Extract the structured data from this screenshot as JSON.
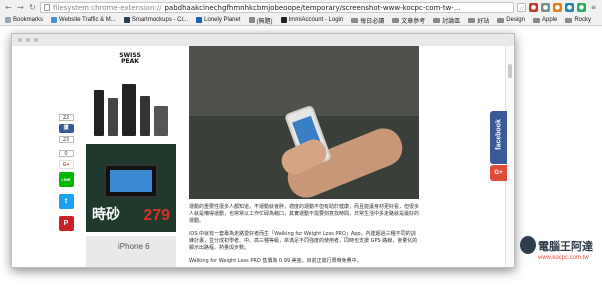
{
  "browser": {
    "url_scheme": "filesystem:chrome-extension://",
    "url_path": "pabdhaakclnechgfhmnhkcbmjobeoope/temporary/screenshot-www-kocpc-com-tw-...",
    "back_icon": "back-arrow-icon",
    "forward_icon": "forward-arrow-icon",
    "reload_icon": "reload-icon",
    "extension_icons": [
      "star-icon",
      "extension-icon-1",
      "extension-icon-2",
      "extension-icon-3",
      "extension-icon-4",
      "extension-icon-5",
      "menu-icon"
    ]
  },
  "bookmarks": {
    "apps_label": "Bookmarks",
    "items": [
      {
        "label": "Website Traffic & M...",
        "type": "page"
      },
      {
        "label": "Smartmockups - Cr...",
        "type": "page"
      },
      {
        "label": "Lonely Planet",
        "type": "page"
      },
      {
        "label": "(無題)",
        "type": "page"
      },
      {
        "label": "ImmiAccount - Login",
        "type": "page"
      },
      {
        "label": "每日必讀",
        "type": "folder"
      },
      {
        "label": "文章參考",
        "type": "folder"
      },
      {
        "label": "討論區",
        "type": "folder"
      },
      {
        "label": "好站",
        "type": "folder"
      },
      {
        "label": "Design",
        "type": "folder"
      },
      {
        "label": "Apple",
        "type": "folder"
      },
      {
        "label": "Rocky",
        "type": "folder"
      }
    ]
  },
  "sidebar_share": {
    "count_top": "22",
    "count_like": "23",
    "count_gplus": "0",
    "like_label": "讚",
    "gplus_label": "G+",
    "line_label": "LINE",
    "twitter_label": "t",
    "pinterest_label": "P"
  },
  "ads": {
    "ad1_logo": "SWISS PEAK",
    "ad2_big": "時砂",
    "ad2_price": "279",
    "ad3_text": "iPhone 6"
  },
  "article": {
    "p1": "運動的重要性很多人都知道，不運動就會胖，適度的運動不但有助於健康，而且能讓身材更好看，但很多人就是懶得運動，也常常以工作忙碌為藉口，其實運動不需要刻意找時間，日常生活中多走路就是最好的運動。",
    "p2": "iOS 中就有一套專為走路愛好者而生「Walking for Weight Loss PRO」App，內建超過三種不同的訓練計畫，並分成初學者、中、高三種等級，來滿足不同強度的使用者，同時也支援 GPS 路線，會量化的顯示出路程、熱量與步數。",
    "p3": "Walking for Weight Loss PRO 售價為 0.99 美金，目前正進行限時免費中。"
  },
  "floating": {
    "facebook_label": "facebook",
    "gplus_label": "G+"
  },
  "watermark": {
    "chinese": "電腦王阿達",
    "url": "www.kocpc.com.tw"
  },
  "colors": {
    "facebook": "#3b5998",
    "gplus": "#dd4b39",
    "line": "#00b900",
    "twitter": "#1da1f2",
    "pinterest": "#cb2027",
    "price": "#d9302a"
  }
}
